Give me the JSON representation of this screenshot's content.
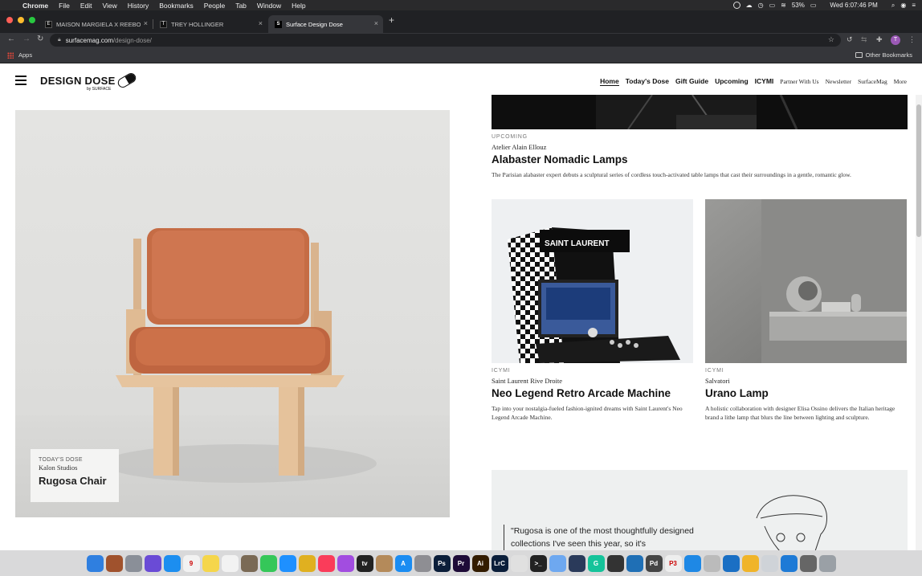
{
  "menubar": {
    "apple": "",
    "items": [
      "Chrome",
      "File",
      "Edit",
      "View",
      "History",
      "Bookmarks",
      "People",
      "Tab",
      "Window",
      "Help"
    ],
    "battery": "53%",
    "clock": "Wed 6:07:46 PM"
  },
  "tabs": [
    {
      "label": "MAISON MARGIELA X REEBOK",
      "favicon": "E"
    },
    {
      "label": "TREY HOLLINGER",
      "favicon": "T"
    },
    {
      "label": "Surface Design Dose",
      "favicon": "S"
    }
  ],
  "omnibox": {
    "domain": "surfacemag.com",
    "path": "/design-dose/"
  },
  "bookmarks": {
    "apps": "Apps",
    "other": "Other Bookmarks"
  },
  "site": {
    "logo": "DESIGN DOSE",
    "logo_sub": "by SURFACE",
    "nav": [
      "Home",
      "Today's Dose",
      "Gift Guide",
      "Upcoming",
      "ICYMI",
      "Partner With Us",
      "Newsletter",
      "SurfaceMag",
      "More"
    ]
  },
  "hero": {
    "kicker": "TODAY'S DOSE",
    "source": "Kalon Studios",
    "title": "Rugosa Chair"
  },
  "articles": [
    {
      "category": "UPCOMING",
      "source": "Atelier Alain Ellouz",
      "title": "Alabaster Nomadic Lamps",
      "desc": "The Parisian alabaster expert debuts a sculptural series of cordless touch-activated table lamps that cast their surroundings in a gentle, romantic glow."
    },
    {
      "category": "ICYMI",
      "source": "Saint Laurent Rive Droite",
      "title": "Neo Legend Retro Arcade Machine",
      "desc": "Tap into your nostalgia-fueled fashion-ignited dreams with Saint Laurent's Neo Legend Arcade Machine.",
      "image_text": "SAINT LAURENT"
    },
    {
      "category": "ICYMI",
      "source": "Salvatori",
      "title": "Urano Lamp",
      "desc": "A holistic collaboration with designer Elisa Ossino delivers the Italian heritage brand a lithe lamp that blurs the line between lighting and sculpture."
    }
  ],
  "quote": {
    "text": "\"Rugosa is one of the most thoughtfully designed collections I've seen this year, so it's"
  },
  "dock": {
    "apps": [
      {
        "name": "finder",
        "color": "#2f7fe0",
        "label": ""
      },
      {
        "name": "notebook",
        "color": "#a0522d",
        "label": ""
      },
      {
        "name": "launchpad",
        "color": "#8a8f98",
        "label": ""
      },
      {
        "name": "siri",
        "color": "#6a4bd6",
        "label": ""
      },
      {
        "name": "safari",
        "color": "#1c8ef0",
        "label": ""
      },
      {
        "name": "calendar",
        "color": "#f2f2f2",
        "label": "9"
      },
      {
        "name": "notes",
        "color": "#f5d64b",
        "label": ""
      },
      {
        "name": "reminders",
        "color": "#f2f2f2",
        "label": ""
      },
      {
        "name": "book",
        "color": "#7a6a55",
        "label": ""
      },
      {
        "name": "messages",
        "color": "#35c759",
        "label": ""
      },
      {
        "name": "messenger",
        "color": "#1e90ff",
        "label": ""
      },
      {
        "name": "chrome",
        "color": "#e0b020",
        "label": ""
      },
      {
        "name": "music",
        "color": "#fa3c5a",
        "label": ""
      },
      {
        "name": "podcasts",
        "color": "#a24de0",
        "label": ""
      },
      {
        "name": "tv",
        "color": "#222",
        "label": "tv"
      },
      {
        "name": "preview",
        "color": "#b48a5a",
        "label": ""
      },
      {
        "name": "appstore",
        "color": "#1a8cf2",
        "label": "A"
      },
      {
        "name": "settings",
        "color": "#8e8e93",
        "label": ""
      },
      {
        "name": "photoshop",
        "color": "#0b1e3a",
        "label": "Ps"
      },
      {
        "name": "premiere",
        "color": "#1e0b38",
        "label": "Pr"
      },
      {
        "name": "illustrator",
        "color": "#331c00",
        "label": "Ai"
      },
      {
        "name": "lightroom",
        "color": "#0b1e3a",
        "label": "LrC"
      },
      {
        "name": "blender",
        "color": "#e0e0e0",
        "label": ""
      },
      {
        "name": "terminal",
        "color": "#222",
        "label": ">_"
      },
      {
        "name": "mail",
        "color": "#6ea8f0",
        "label": ""
      },
      {
        "name": "tools",
        "color": "#2a3a5a",
        "label": ""
      },
      {
        "name": "grammarly",
        "color": "#15c39a",
        "label": "G"
      },
      {
        "name": "davinci",
        "color": "#333",
        "label": ""
      },
      {
        "name": "screen",
        "color": "#1f6fb5",
        "label": ""
      },
      {
        "name": "acrobat",
        "color": "#444",
        "label": "Pd"
      },
      {
        "name": "p3",
        "color": "#eee",
        "label": "P3"
      },
      {
        "name": "xcode",
        "color": "#1e88e5",
        "label": ""
      },
      {
        "name": "game",
        "color": "#bbb",
        "label": ""
      },
      {
        "name": "vscode",
        "color": "#1a6fc4",
        "label": ""
      },
      {
        "name": "coin",
        "color": "#f0b429",
        "label": ""
      },
      {
        "name": "photos-tool",
        "color": "#cfd3d8",
        "label": ""
      },
      {
        "name": "edge",
        "color": "#1e7ad6",
        "label": ""
      },
      {
        "name": "downloads",
        "color": "#666",
        "label": ""
      },
      {
        "name": "trash",
        "color": "#9aa0a6",
        "label": ""
      }
    ]
  }
}
